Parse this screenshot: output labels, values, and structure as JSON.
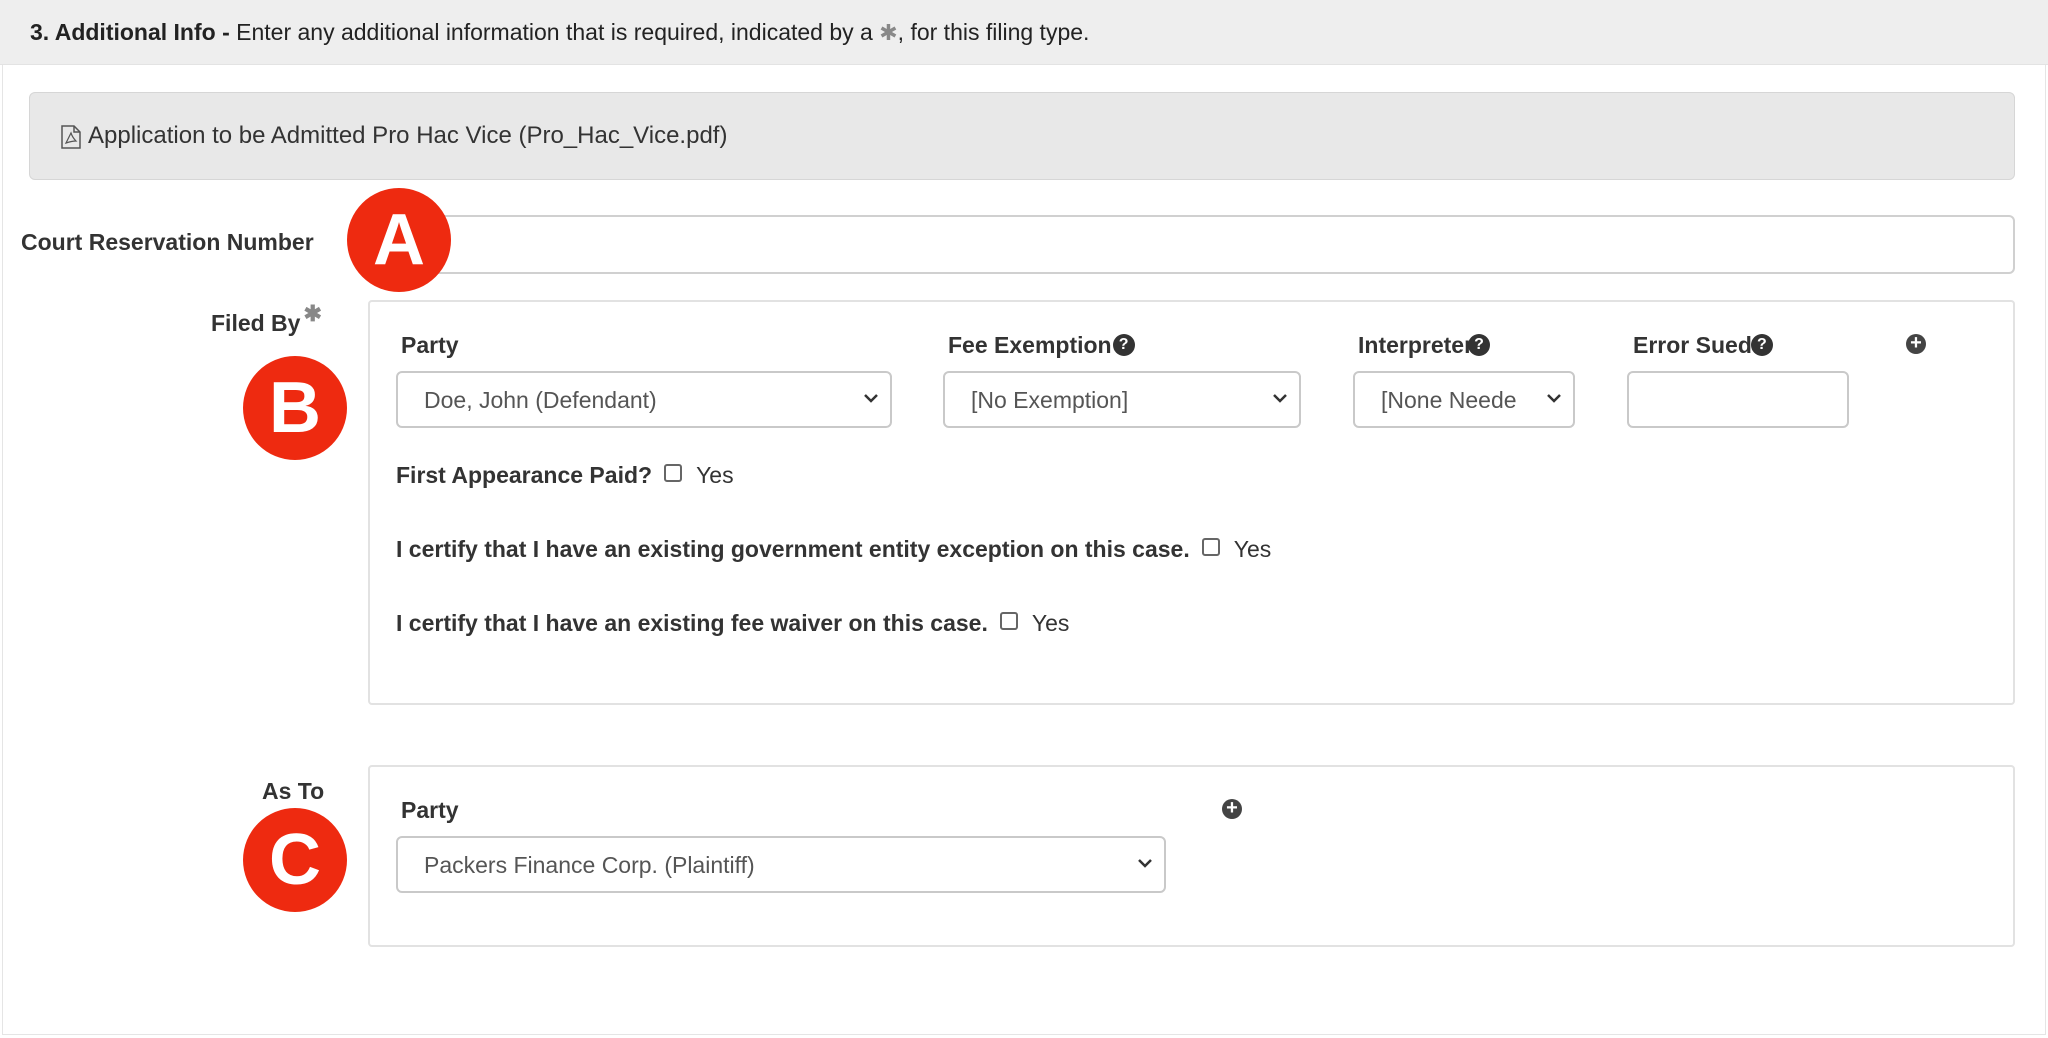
{
  "header": {
    "step_title": "3. Additional Info -",
    "instruction_before": " Enter any additional information that is required, indicated by a ",
    "required_marker": "✱",
    "instruction_after": ", for this filing type."
  },
  "document": {
    "icon": "pdf-file-icon",
    "label": "Application to be Admitted Pro Hac Vice (Pro_Hac_Vice.pdf)"
  },
  "court_reservation": {
    "label": "Court Reservation Number",
    "value": ""
  },
  "filed_by": {
    "label": "Filed By",
    "required_marker": "✱",
    "columns": {
      "party": "Party",
      "fee_exemption": "Fee Exemption",
      "interpreter": "Interpreter",
      "error_sued": "Error Sued"
    },
    "help_glyph": "?",
    "add_glyph": "+",
    "party_value": "Doe, John (Defendant)",
    "fee_exemption_value": "[No Exemption]",
    "interpreter_value": "[None Neede",
    "error_sued_value": "",
    "first_appearance": {
      "question": "First Appearance Paid?",
      "option": "Yes",
      "checked": false
    },
    "government_exception": {
      "question": "I certify that I have an existing government entity exception on this case.",
      "option": "Yes",
      "checked": false
    },
    "fee_waiver": {
      "question": "I certify that I have an existing fee waiver on this case.",
      "option": "Yes",
      "checked": false
    }
  },
  "as_to": {
    "label": "As To",
    "party_label": "Party",
    "add_glyph": "+",
    "party_value": "Packers Finance Corp. (Plaintiff)"
  },
  "annotations": {
    "a": "A",
    "b": "B",
    "c": "C",
    "color": "#ee2a10"
  },
  "colors": {
    "header_bg": "#eeeeee",
    "document_bar_bg": "#e8e8e8",
    "border": "#d0d0d0"
  }
}
